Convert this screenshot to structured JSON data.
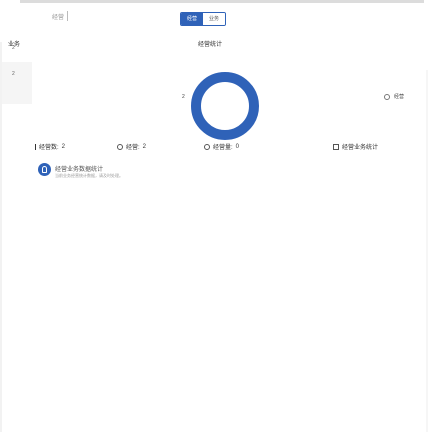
{
  "toolbar": {
    "filter_text": "经营",
    "tabs": [
      {
        "label": "经营",
        "active": true
      },
      {
        "label": "业务",
        "active": false
      }
    ]
  },
  "summary": {
    "row_label": "业务",
    "section_title": "经营统计"
  },
  "side_nav": {
    "items": [
      "2",
      "2"
    ]
  },
  "chart": {
    "value_label": "2",
    "legend_label": "经营"
  },
  "stats": [
    {
      "label": "经营数:",
      "value": "2",
      "icon": "bar-icon"
    },
    {
      "label": "经营:",
      "value": "2",
      "icon": "circle-icon"
    },
    {
      "label": "经营量:",
      "value": "0",
      "icon": "circle-icon"
    },
    {
      "label": "经营业务统计",
      "value": "",
      "icon": "box-icon"
    }
  ],
  "notice": {
    "title": "经营业务数据统计",
    "subtitle": "当前业务经营统计数据，请及时处理。"
  },
  "colors": {
    "primary": "#2f62b8",
    "text": "#333333",
    "muted": "#999999"
  },
  "chart_data": {
    "type": "pie",
    "title": "经营统计",
    "values": [
      2
    ],
    "categories": [
      "经营"
    ]
  }
}
